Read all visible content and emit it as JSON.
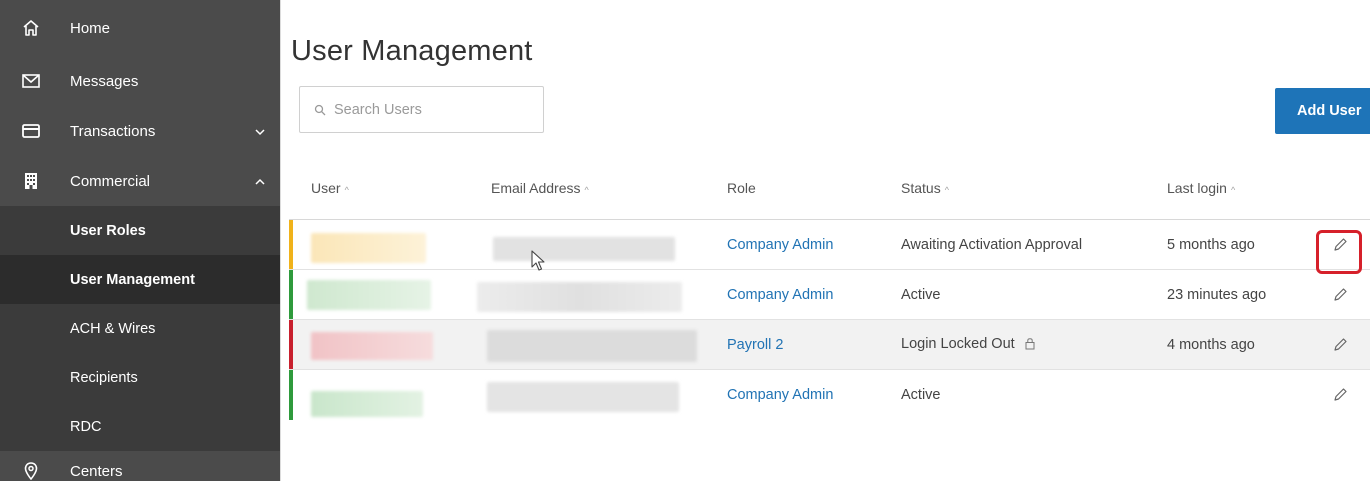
{
  "sidebar": {
    "items": [
      {
        "label": "Home",
        "icon": "home-icon"
      },
      {
        "label": "Messages",
        "icon": "mail-icon"
      },
      {
        "label": "Transactions",
        "icon": "card-icon",
        "expanded": false
      },
      {
        "label": "Commercial",
        "icon": "building-icon",
        "expanded": true
      },
      {
        "label": "Centers",
        "icon": "location-pin-icon"
      }
    ],
    "sub_items": [
      {
        "label": "User Roles"
      },
      {
        "label": "User Management",
        "active": true
      },
      {
        "label": "ACH & Wires"
      },
      {
        "label": "Recipients"
      },
      {
        "label": "RDC"
      }
    ]
  },
  "main": {
    "title": "User Management",
    "search": {
      "placeholder": "Search Users"
    },
    "add_user_label": "Add User",
    "columns": {
      "user": "User",
      "email": "Email Address",
      "role": "Role",
      "status": "Status",
      "last_login": "Last login"
    },
    "rows": [
      {
        "role": "Company Admin",
        "status": "Awaiting Activation Approval",
        "last_login": "5 months ago",
        "status_color": "#f0b21a"
      },
      {
        "role": "Company Admin",
        "status": "Active",
        "last_login": "23 minutes ago",
        "status_color": "#2e9a3c"
      },
      {
        "role": "Payroll 2",
        "status": "Login Locked Out",
        "last_login": "4 months ago",
        "status_color": "#c8202e"
      },
      {
        "role": "Company Admin",
        "status": "Active",
        "last_login": "",
        "status_color": "#2e9a3c"
      }
    ]
  },
  "colors": {
    "sidebar_bg": "#4b4b4b",
    "accent": "#1e74b8",
    "link": "#2173b4",
    "highlight": "#d6202a"
  }
}
